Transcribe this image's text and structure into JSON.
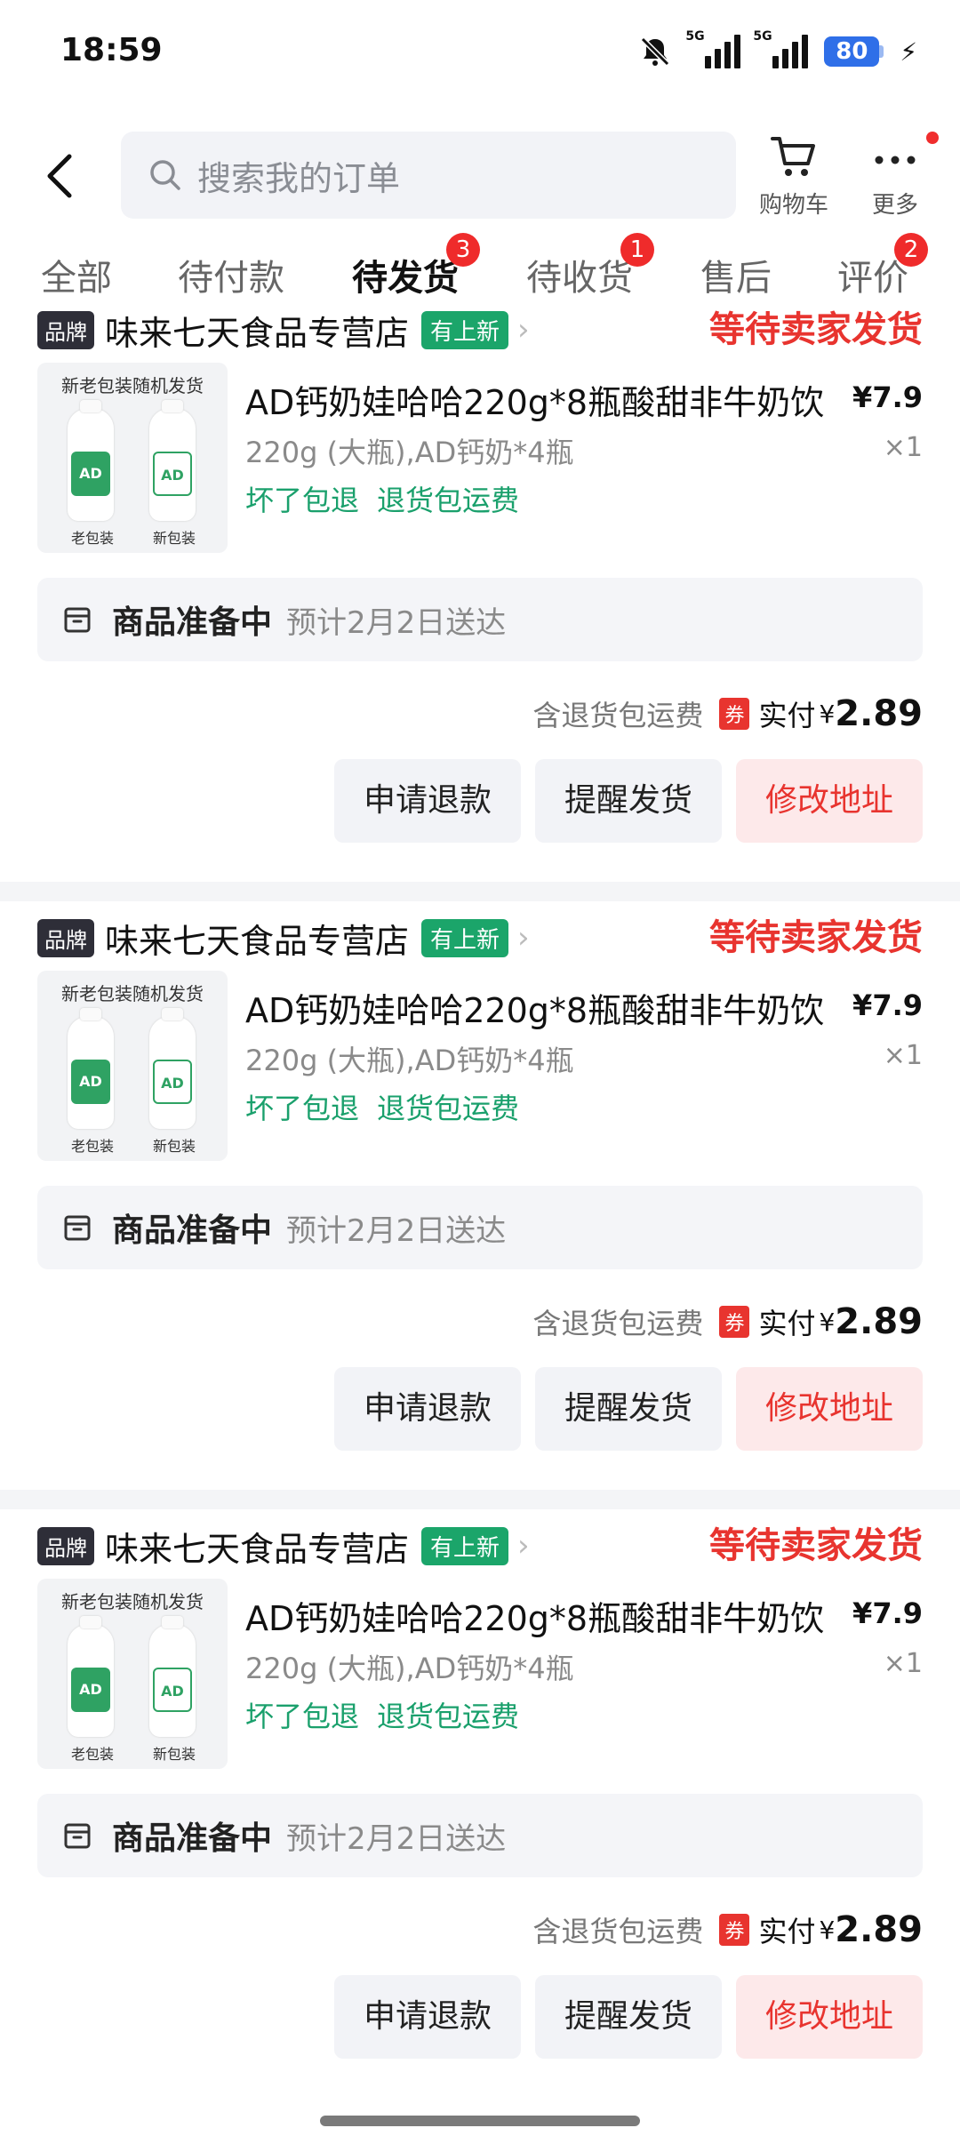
{
  "status_bar": {
    "time": "18:59",
    "signal_label_1": "5G",
    "signal_label_2": "5G",
    "battery": "80",
    "icons": [
      "bell-off-icon",
      "signal-icon",
      "signal-icon",
      "battery-icon",
      "charging-icon"
    ]
  },
  "header": {
    "search_placeholder": "搜索我的订单",
    "cart_label": "购物车",
    "more_label": "更多"
  },
  "tabs": [
    {
      "label": "全部",
      "badge": ""
    },
    {
      "label": "待付款",
      "badge": ""
    },
    {
      "label": "待发货",
      "badge": "3"
    },
    {
      "label": "待收货",
      "badge": "1"
    },
    {
      "label": "售后",
      "badge": ""
    },
    {
      "label": "评价",
      "badge": "2"
    }
  ],
  "active_tab": "待发货",
  "orders": [
    {
      "brand_tag": "品牌",
      "shop": "味来七天食品专营店",
      "new_tag": "有上新",
      "status": "等待卖家发货",
      "img_top": "新老包装随机发货",
      "img_left": "老包装",
      "img_right": "新包装",
      "title": "AD钙奶娃哈哈220g*8瓶酸甜非牛奶饮",
      "spec": "220g (大瓶),AD钙奶*4瓶",
      "service_1": "坏了包退",
      "service_2": "退货包运费",
      "price": "¥7.9",
      "qty": "×1",
      "log_status": "商品准备中",
      "log_eta": "预计2月2日送达",
      "pay_note": "含退货包运费",
      "coupon": "券",
      "paid_label": "实付",
      "currency": "¥",
      "paid": "2.89",
      "btn_refund": "申请退款",
      "btn_remind": "提醒发货",
      "btn_address": "修改地址"
    },
    {
      "brand_tag": "品牌",
      "shop": "味来七天食品专营店",
      "new_tag": "有上新",
      "status": "等待卖家发货",
      "img_top": "新老包装随机发货",
      "img_left": "老包装",
      "img_right": "新包装",
      "title": "AD钙奶娃哈哈220g*8瓶酸甜非牛奶饮",
      "spec": "220g (大瓶),AD钙奶*4瓶",
      "service_1": "坏了包退",
      "service_2": "退货包运费",
      "price": "¥7.9",
      "qty": "×1",
      "log_status": "商品准备中",
      "log_eta": "预计2月2日送达",
      "pay_note": "含退货包运费",
      "coupon": "券",
      "paid_label": "实付",
      "currency": "¥",
      "paid": "2.89",
      "btn_refund": "申请退款",
      "btn_remind": "提醒发货",
      "btn_address": "修改地址"
    },
    {
      "brand_tag": "品牌",
      "shop": "味来七天食品专营店",
      "new_tag": "有上新",
      "status": "等待卖家发货",
      "img_top": "新老包装随机发货",
      "img_left": "老包装",
      "img_right": "新包装",
      "title": "AD钙奶娃哈哈220g*8瓶酸甜非牛奶饮",
      "spec": "220g (大瓶),AD钙奶*4瓶",
      "service_1": "坏了包退",
      "service_2": "退货包运费",
      "price": "¥7.9",
      "qty": "×1",
      "log_status": "商品准备中",
      "log_eta": "预计2月2日送达",
      "pay_note": "含退货包运费",
      "coupon": "券",
      "paid_label": "实付",
      "currency": "¥",
      "paid": "2.89",
      "btn_refund": "申请退款",
      "btn_remind": "提醒发货",
      "btn_address": "修改地址"
    }
  ],
  "colors": {
    "accent_red": "#e8342f",
    "service_green": "#1aa06c",
    "new_tag_green": "#1ba56a",
    "badge_red": "#ef2b2b"
  }
}
